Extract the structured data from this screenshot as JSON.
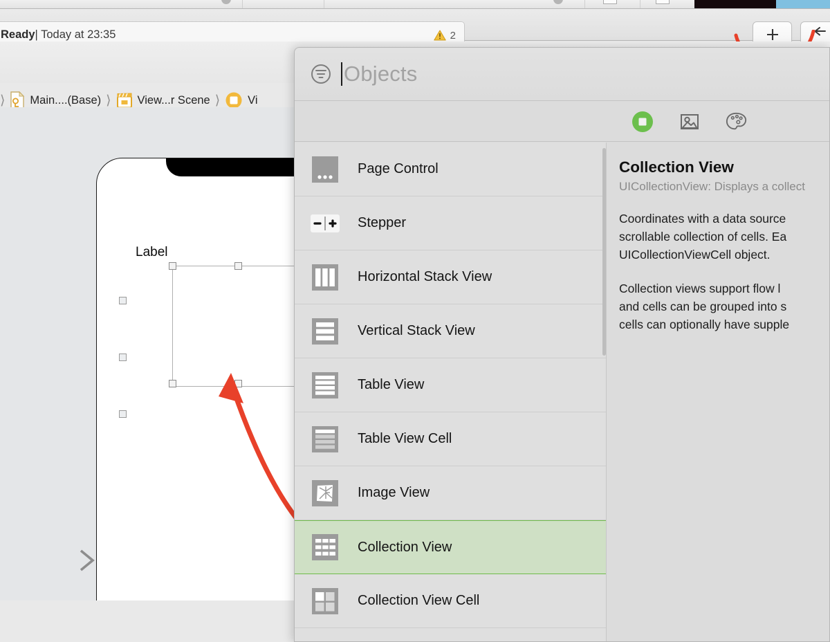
{
  "statusbar": {
    "state": "Ready",
    "separator": "|",
    "timestamp": "Today at 23:35",
    "issue_count": "2",
    "warning_icon": "warning-triangle-icon"
  },
  "toolbar": {
    "add_label": "+",
    "back_label": "←",
    "annotation_color": "#e8412a"
  },
  "breadcrumb": {
    "items": [
      {
        "label": "",
        "icon": "project-icon"
      },
      {
        "label": "Main....(Base)",
        "icon": "storyboard-file-icon"
      },
      {
        "label": "View...r Scene",
        "icon": "scene-icon"
      },
      {
        "label": "Vi",
        "icon": "view-controller-icon"
      }
    ],
    "separator": "〉"
  },
  "jump_field": {
    "value": "",
    "placeholder": "",
    "icons": [
      "view-controller-circle-icon",
      "cube-icon"
    ]
  },
  "canvas": {
    "device_label": "Label",
    "entry_arrow": "storyboard-entry-point-arrow",
    "selected_object": "selected-view-outline",
    "annotation_arrow": "red-pointer-arrow"
  },
  "library": {
    "search": {
      "placeholder": "Objects",
      "value": "",
      "filter_icon": "filter-icon"
    },
    "tabs": [
      {
        "name": "objects-tab",
        "icon": "green-object-icon",
        "selected": true
      },
      {
        "name": "media-tab",
        "icon": "image-icon",
        "selected": false
      },
      {
        "name": "color-tab",
        "icon": "palette-icon",
        "selected": false
      }
    ],
    "items": [
      {
        "label": "Page Control",
        "icon": "page-control-icon",
        "selected": false
      },
      {
        "label": "Stepper",
        "icon": "stepper-icon",
        "selected": false
      },
      {
        "label": "Horizontal Stack View",
        "icon": "horizontal-stack-view-icon",
        "selected": false
      },
      {
        "label": "Vertical Stack View",
        "icon": "vertical-stack-view-icon",
        "selected": false
      },
      {
        "label": "Table View",
        "icon": "table-view-icon",
        "selected": false
      },
      {
        "label": "Table View Cell",
        "icon": "table-view-cell-icon",
        "selected": false
      },
      {
        "label": "Image View",
        "icon": "image-view-icon",
        "selected": false
      },
      {
        "label": "Collection View",
        "icon": "collection-view-icon",
        "selected": true
      },
      {
        "label": "Collection View Cell",
        "icon": "collection-view-cell-icon",
        "selected": false
      }
    ],
    "detail": {
      "title": "Collection View",
      "subtitle": "UICollectionView: Displays a collect",
      "paragraph_1": "Coordinates with a data source\nscrollable collection of cells. Ea\nUICollectionViewCell object.",
      "paragraph_2": "Collection views support flow l\nand cells can be grouped into s\ncells can optionally have supple"
    },
    "selection_color": "#cfe0c5",
    "selection_border_color": "#6fbb4a"
  }
}
